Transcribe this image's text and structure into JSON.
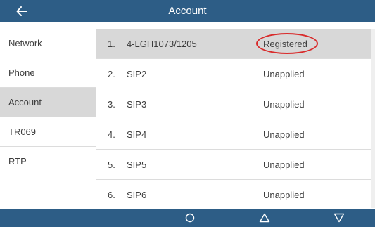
{
  "header": {
    "title": "Account",
    "back_icon": "arrow-left-icon"
  },
  "sidebar": {
    "items": [
      {
        "label": "Network",
        "active": false
      },
      {
        "label": "Phone",
        "active": false
      },
      {
        "label": "Account",
        "active": true
      },
      {
        "label": "TR069",
        "active": false
      },
      {
        "label": "RTP",
        "active": false
      },
      {
        "label": "",
        "active": false
      }
    ]
  },
  "accounts": [
    {
      "number": "1.",
      "name": "4-LGH1073/1205",
      "status": "Registered",
      "selected": true,
      "highlighted": true
    },
    {
      "number": "2.",
      "name": "SIP2",
      "status": "Unapplied",
      "selected": false
    },
    {
      "number": "3.",
      "name": "SIP3",
      "status": "Unapplied",
      "selected": false
    },
    {
      "number": "4.",
      "name": "SIP4",
      "status": "Unapplied",
      "selected": false
    },
    {
      "number": "5.",
      "name": "SIP5",
      "status": "Unapplied",
      "selected": false
    },
    {
      "number": "6.",
      "name": "SIP6",
      "status": "Unapplied",
      "selected": false
    }
  ],
  "softkeys": [
    {
      "name": "ok-circle-icon",
      "symbol": "○"
    },
    {
      "name": "triangle-up-icon",
      "symbol": "△"
    },
    {
      "name": "triangle-down-icon",
      "symbol": "▽"
    }
  ],
  "colors": {
    "bar": "#2d5d86",
    "selected_row": "#d8d8d8",
    "highlight_circle": "#d92b2b"
  }
}
